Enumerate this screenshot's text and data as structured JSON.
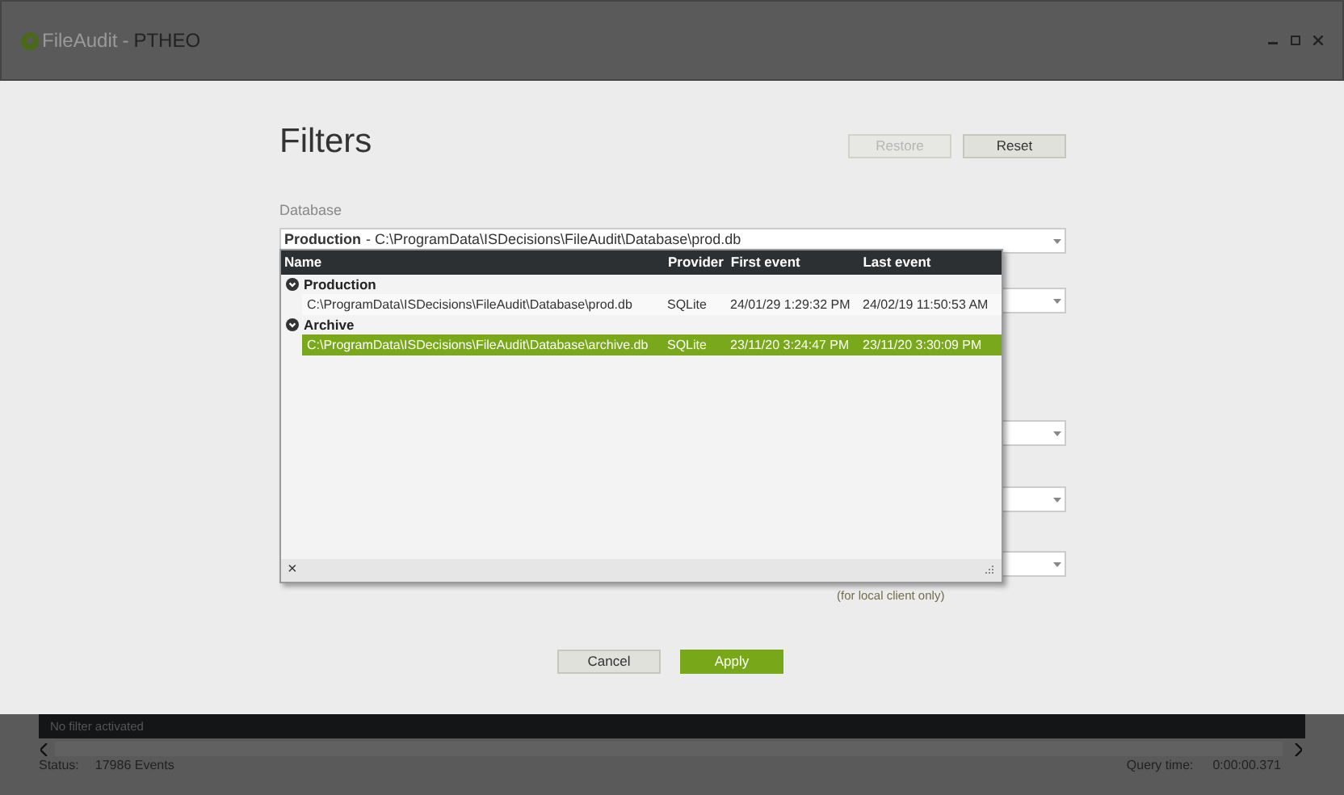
{
  "window": {
    "app": "FileAudit",
    "separator": "-",
    "title": "PTHEO"
  },
  "dialog": {
    "title": "Filters",
    "buttons": [
      {
        "label": "Restore",
        "disabled": true
      },
      {
        "label": "Reset",
        "disabled": false
      }
    ],
    "database": {
      "label": "Database",
      "value_name": "Production",
      "value_path": "- C:\\ProgramData\\ISDecisions\\FileAudit\\Database\\prod.db"
    },
    "note": "(for local client only)",
    "popup": {
      "columns": [
        "Name",
        "Provider",
        "First event",
        "Last event"
      ],
      "groups": [
        {
          "name": "Production",
          "expanded": true,
          "rows": [
            {
              "path": "C:\\ProgramData\\ISDecisions\\FileAudit\\Database\\prod.db",
              "provider": "SQLite",
              "first": "24/01/29 1:29:32 PM",
              "last": "24/02/19 11:50:53 AM",
              "selected": false
            }
          ]
        },
        {
          "name": "Archive",
          "expanded": true,
          "rows": [
            {
              "path": "C:\\ProgramData\\ISDecisions\\FileAudit\\Database\\archive.db",
              "provider": "SQLite",
              "first": "23/11/20 3:24:47 PM",
              "last": "23/11/20 3:30:09 PM",
              "selected": true
            }
          ]
        }
      ],
      "close": "×"
    },
    "actions": [
      {
        "label": "Cancel",
        "kind": "secondary"
      },
      {
        "label": "Apply",
        "kind": "primary"
      }
    ]
  },
  "filter_bar": "No filter activated",
  "status_bar": {
    "status_label": "Status:",
    "status_value": "17986 Events",
    "query_label": "Query time:",
    "query_value": "0:00:00.371"
  }
}
